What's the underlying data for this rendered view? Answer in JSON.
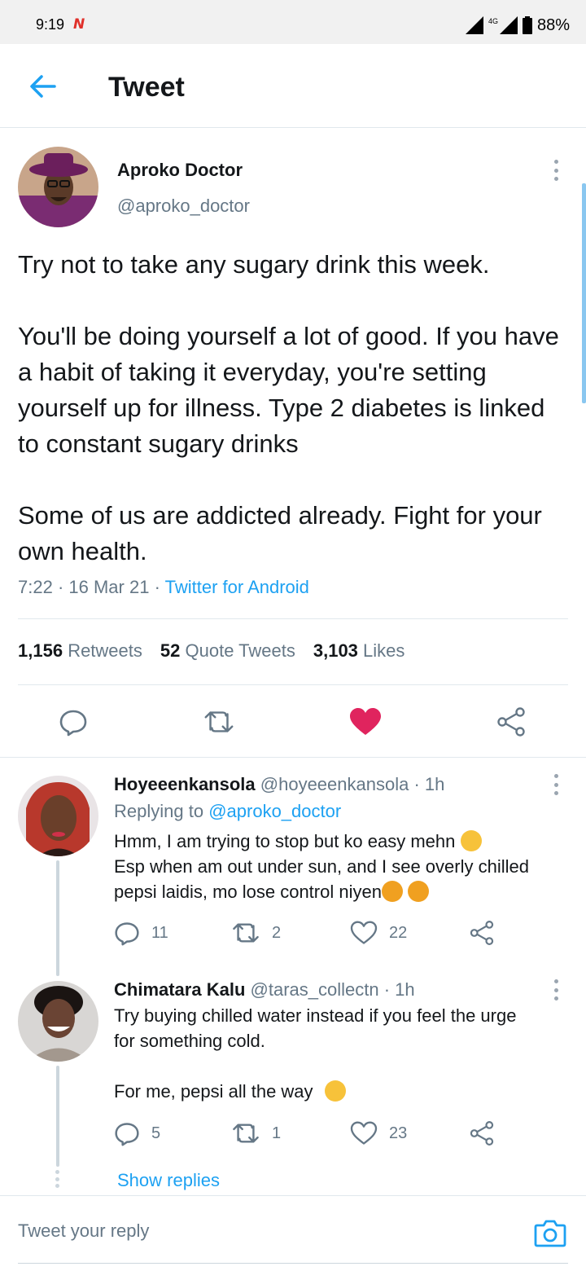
{
  "status_bar": {
    "time": "9:19",
    "notification_icon": "news-app-icon",
    "battery": "88%",
    "network": "4G",
    "icons": [
      "signal-icon",
      "mobile-data-icon",
      "battery-icon"
    ]
  },
  "header": {
    "back_icon": "back-arrow-icon",
    "title": "Tweet"
  },
  "tweet": {
    "author_name": "Aproko Doctor",
    "author_handle": "@aproko_doctor",
    "paragraphs": [
      "Try not to take any sugary drink this week.",
      "You'll be doing yourself a lot of good. If you have a habit of taking it everyday, you're setting yourself up for illness. Type 2 diabetes is linked to constant sugary drinks",
      "Some of us are addicted already. Fight for your own health."
    ],
    "time": "7:22",
    "date": "16 Mar 21",
    "source": "Twitter for Android",
    "stats": {
      "retweets_count": "1,156",
      "retweets_label": "Retweets",
      "quotes_count": "52",
      "quotes_label": "Quote Tweets",
      "likes_count": "3,103",
      "likes_label": "Likes"
    },
    "liked": true,
    "accent_color": "#1da1f2",
    "like_color": "#e0245e"
  },
  "replies": [
    {
      "name": "Hoyeeenkansola",
      "handle": "@hoyeeenkansola",
      "age": "1h",
      "replying_label": "Replying to",
      "replying_to": "@aproko_doctor",
      "line1": "Hmm, I am trying to stop but ko easy mehn",
      "line2": "Esp when am out under sun, and I see overly chilled",
      "line3": "pepsi laidis, mo lose control niyen",
      "emojis": [
        "weary-face-emoji",
        "person-facepalming-emoji",
        "person-facepalming-emoji"
      ],
      "reply_count": "11",
      "retweet_count": "2",
      "like_count": "22"
    },
    {
      "name": "Chimatara Kalu",
      "handle": "@taras_collectn",
      "age": "1h",
      "line1": "Try buying chilled water instead if you feel the urge",
      "line2": "for something cold.",
      "line3": "For me, pepsi all the way",
      "emojis": [
        "face-savoring-food-emoji"
      ],
      "reply_count": "5",
      "retweet_count": "1",
      "like_count": "23"
    }
  ],
  "show_replies": "Show replies",
  "composer": {
    "placeholder": "Tweet your reply",
    "camera_icon": "camera-icon"
  }
}
